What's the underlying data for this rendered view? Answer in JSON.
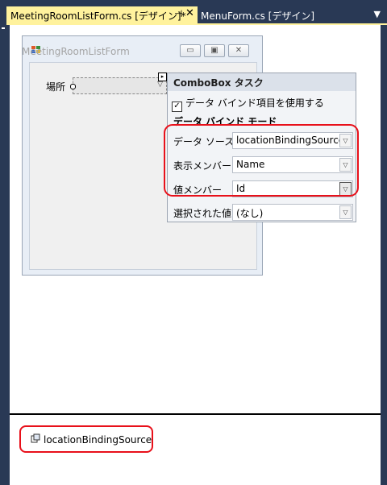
{
  "tabs": {
    "active": {
      "label": "MeetingRoomListForm.cs [デザイン]*",
      "pin": "⊣",
      "close": "✕"
    },
    "inactive": {
      "label": "MenuForm.cs [デザイン]"
    },
    "dropdown": "▼"
  },
  "form": {
    "title": "MeetingRoomListForm",
    "buttons": {
      "minimize": "▭",
      "maximize": "▣",
      "close": "✕"
    },
    "place_label": "場所"
  },
  "tasks": {
    "header": "ComboBox タスク",
    "use_binding": {
      "checked": true,
      "label": "データ バインド項目を使用する"
    },
    "mode_heading": "データ バインド モード",
    "rows": [
      {
        "label": "データ ソース",
        "value": "locationBindingSource"
      },
      {
        "label": "表示メンバー",
        "value": "Name"
      },
      {
        "label": "値メンバー",
        "value": "Id"
      },
      {
        "label": "選択された値",
        "value": "(なし)"
      }
    ]
  },
  "tray": {
    "component": "locationBindingSource"
  },
  "colors": {
    "accent_tab": "#fff29d",
    "frame": "#293955",
    "highlight": "#e8101a"
  }
}
